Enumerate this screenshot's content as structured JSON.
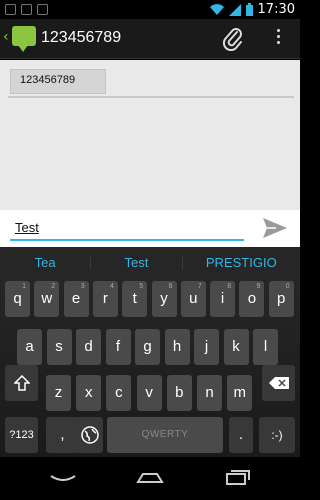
{
  "status_bar": {
    "time": "17:30"
  },
  "action_bar": {
    "title": "123456789"
  },
  "conversation": {
    "recipient": "123456789"
  },
  "compose": {
    "text": "Test"
  },
  "suggestions": [
    "Tea",
    "Test",
    "PRESTIGIO"
  ],
  "keyboard": {
    "row1": [
      {
        "label": "q",
        "hint": "1"
      },
      {
        "label": "w",
        "hint": "2"
      },
      {
        "label": "e",
        "hint": "3"
      },
      {
        "label": "r",
        "hint": "4"
      },
      {
        "label": "t",
        "hint": "5"
      },
      {
        "label": "y",
        "hint": "6"
      },
      {
        "label": "u",
        "hint": "7"
      },
      {
        "label": "i",
        "hint": "8"
      },
      {
        "label": "o",
        "hint": "9"
      },
      {
        "label": "p",
        "hint": "0"
      }
    ],
    "row2": [
      {
        "label": "a"
      },
      {
        "label": "s"
      },
      {
        "label": "d"
      },
      {
        "label": "f"
      },
      {
        "label": "g"
      },
      {
        "label": "h"
      },
      {
        "label": "j"
      },
      {
        "label": "k"
      },
      {
        "label": "l"
      }
    ],
    "row3": [
      {
        "label": "z"
      },
      {
        "label": "x"
      },
      {
        "label": "c"
      },
      {
        "label": "v"
      },
      {
        "label": "b"
      },
      {
        "label": "n"
      },
      {
        "label": "m"
      }
    ],
    "symbols_label": "?123",
    "comma_label": ",",
    "space_label": "QWERTY",
    "period_label": ".",
    "smiley_label": ":-)"
  },
  "colors": {
    "accent": "#33b5e5",
    "app_green": "#8cc63f"
  }
}
